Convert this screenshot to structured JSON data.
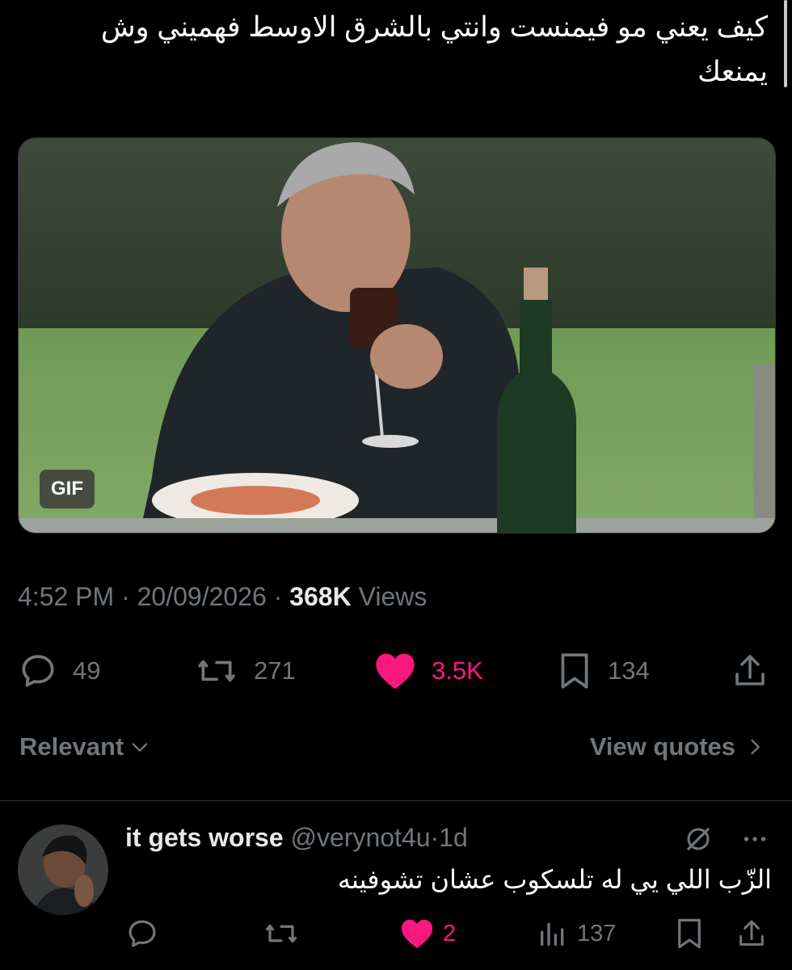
{
  "tweet": {
    "text": "كيف يعني مو فيمنست وانتي بالشرق الاوسط فهميني وش يمنعك",
    "media_badge": "GIF",
    "time": "4:52 PM",
    "date": "20/09/2026",
    "views_count": "368K",
    "views_label": "Views",
    "separator": "·"
  },
  "actions": {
    "replies": "49",
    "reposts": "271",
    "likes": "3.5K",
    "bookmarks": "134"
  },
  "sort": {
    "label": "Relevant",
    "quotes_label": "View quotes"
  },
  "reply": {
    "name": "it gets worse",
    "handle": "@verynot4u",
    "age": "1d",
    "separator": "·",
    "text": "الزّب اللي يي له تلسكوب عشان تشوفينه",
    "likes": "2",
    "views": "137"
  },
  "colors": {
    "background": "#000000",
    "muted": "#71767b",
    "like": "#f91880",
    "divider": "#2f3336"
  }
}
